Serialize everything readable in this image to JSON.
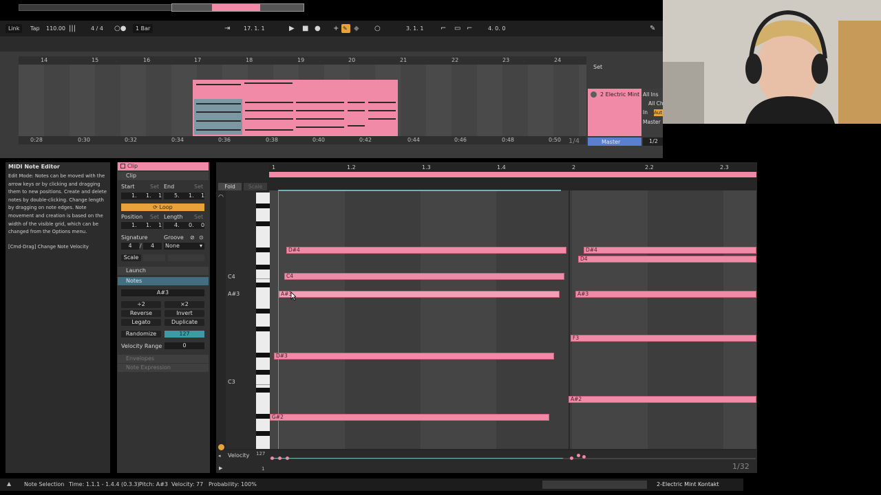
{
  "control_bar": {
    "link": "Link",
    "tap": "Tap",
    "tempo": "110.00",
    "time_signature": "4 / 4",
    "quantization": "1 Bar",
    "position": "17.  1.  1",
    "loop_start": "3.  1.  1",
    "loop_length": "4.  0.  0"
  },
  "arrangement": {
    "bar_numbers": [
      "14",
      "15",
      "16",
      "17",
      "18",
      "19",
      "20",
      "21",
      "22",
      "23",
      "24"
    ],
    "time_marks": [
      "0:28",
      "0:30",
      "0:32",
      "0:34",
      "0:36",
      "0:38",
      "0:40",
      "0:42",
      "0:44",
      "0:46",
      "0:48",
      "0:50"
    ],
    "fraction": "1/4",
    "set_label": "Set",
    "track_name": "2 Electric Mint",
    "master": "Master",
    "io": {
      "input_type": "All Ins",
      "input_channel": "All Ch",
      "monitor": "In",
      "auto": "Aut",
      "output": "Master"
    },
    "half": "1/2",
    "value_a": "0",
    "value_b": "0"
  },
  "info_view": {
    "title": "MIDI Note Editor",
    "body": "Edit Mode: Notes can be moved with the arrow keys or by clicking and dragging them to new positions. Create and delete notes by double-clicking. Change length by dragging on note edges. Note movement and creation is based on the width of the visible grid, which can be changed from the Options menu.",
    "shortcut": "[Cmd-Drag] Change Note Velocity"
  },
  "clip_view": {
    "header": "Clip",
    "section_clip": "Clip",
    "start_label": "Start",
    "end_label": "End",
    "set": "Set",
    "start_value": [
      "1.",
      "1.",
      "1"
    ],
    "end_value": [
      "5.",
      "1.",
      "1"
    ],
    "loop": "Loop",
    "position_label": "Position",
    "length_label": "Length",
    "position_value": [
      "1.",
      "1.",
      "1"
    ],
    "length_value": [
      "4.",
      "0.",
      "0"
    ],
    "signature_label": "Signature",
    "groove_label": "Groove",
    "sig_num": "4",
    "sig_den": "4",
    "groove_value": "None",
    "scale": "Scale",
    "launch": "Launch",
    "notes": "Notes",
    "selected_note": "A#3",
    "div2": "÷2",
    "mul2": "×2",
    "reverse": "Reverse",
    "invert": "Invert",
    "legato": "Legato",
    "duplicate": "Duplicate",
    "randomize": "Randomize",
    "randomize_value": "127",
    "velocity_range": "Velocity Range",
    "velocity_range_value": "0",
    "envelopes": "Envelopes",
    "note_expression": "Note Expression"
  },
  "midi_editor": {
    "fold": "Fold",
    "scale": "Scale",
    "beats": [
      "1",
      "1.2",
      "1.3",
      "1.4",
      "2",
      "2.2",
      "2.3"
    ],
    "octave_labels": [
      "C4",
      "A#3",
      "C3"
    ],
    "notes": [
      {
        "name": "D#4"
      },
      {
        "name": "D#4"
      },
      {
        "name": "D4"
      },
      {
        "name": "C4"
      },
      {
        "name": "A#3"
      },
      {
        "name": "A#3"
      },
      {
        "name": "F3"
      },
      {
        "name": "D#3"
      },
      {
        "name": "A#2"
      },
      {
        "name": "G#2"
      }
    ],
    "velocity_label": "Velocity",
    "velocity_max": "127",
    "velocity_min": "1",
    "page_fraction": "1/32"
  },
  "status_bar": {
    "mode": "Note Selection",
    "time": "Time: 1.1.1 - 1.4.4 (0.3.3)",
    "pitch": "Pitch: A#3",
    "velocity": "Velocity: 77",
    "probability": "Probability: 100%",
    "track": "2-Electric Mint Kontakt"
  },
  "colors": {
    "clip_pink": "#f08aa6",
    "loop_orange": "#e7a33a",
    "notes_blue": "#426e82",
    "master_blue": "#5a7fcf",
    "teal": "#3f9aa6"
  }
}
